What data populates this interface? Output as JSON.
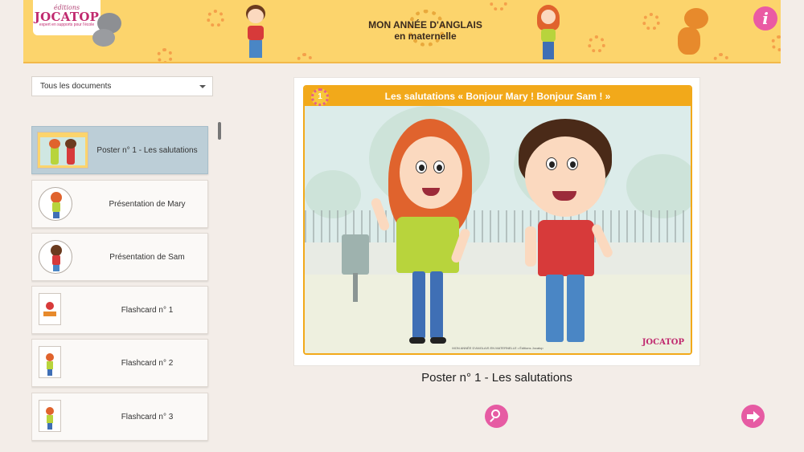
{
  "header": {
    "logo_small": "éditions",
    "logo_big": "JOCATOP",
    "logo_tagline": "expert en supports pour l'école",
    "title_line1": "MON ANNÉE D'ANGLAIS",
    "title_line2": "en maternelle",
    "info_icon": "info-icon"
  },
  "filter": {
    "selected": "Tous les documents"
  },
  "documents": [
    {
      "label": "Poster n° 1 - Les salutations",
      "thumb": "poster"
    },
    {
      "label": "Présentation de Mary",
      "thumb": "mary"
    },
    {
      "label": "Présentation de Sam",
      "thumb": "sam"
    },
    {
      "label": "Flashcard n° 1",
      "thumb": "card"
    },
    {
      "label": "Flashcard n° 2",
      "thumb": "card"
    },
    {
      "label": "Flashcard n° 3",
      "thumb": "card"
    }
  ],
  "poster": {
    "number": "1",
    "title": "Les salutations « Bonjour Mary ! Bonjour Sam ! »",
    "footer": "MON ANNÉE D'ANGLAIS EN MATERNELLE • Éditions Jocatop",
    "logo": "JOCATOP"
  },
  "caption": "Poster n° 1 - Les salutations",
  "colors": {
    "banner": "#fcd46c",
    "accent_pink": "#e65ba3",
    "active_card": "#bcced7",
    "poster_orange": "#f2a91a"
  }
}
